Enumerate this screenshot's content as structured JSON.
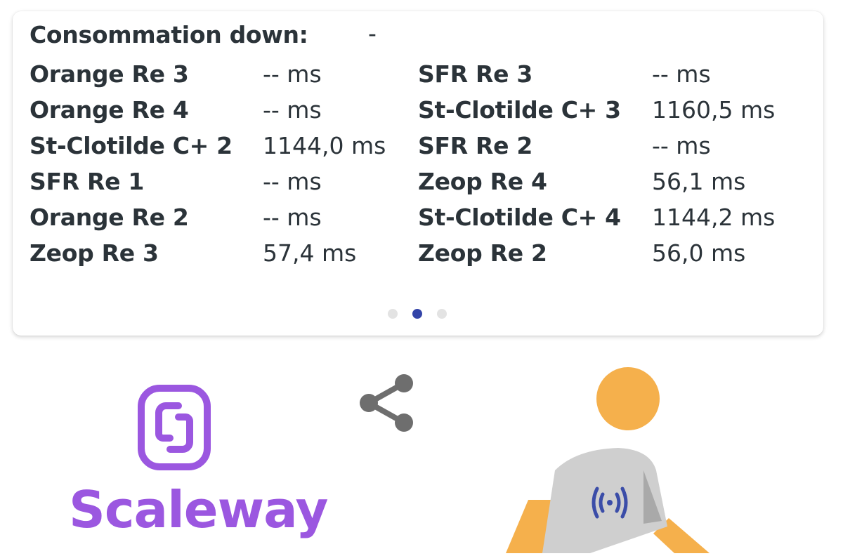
{
  "card": {
    "header": {
      "label": "Consommation down:",
      "value": "-"
    },
    "left_rows": [
      {
        "name": "Orange Re 3",
        "value": "-- ms"
      },
      {
        "name": "Orange Re 4",
        "value": "-- ms"
      },
      {
        "name": "St-Clotilde C+ 2",
        "value": "1144,0 ms"
      },
      {
        "name": "SFR Re 1",
        "value": "-- ms"
      },
      {
        "name": "Orange Re 2",
        "value": "-- ms"
      },
      {
        "name": "Zeop Re 3",
        "value": "57,4 ms"
      }
    ],
    "right_rows": [
      {
        "name": "SFR Re 3",
        "value": "-- ms"
      },
      {
        "name": "St-Clotilde C+ 3",
        "value": "1160,5 ms"
      },
      {
        "name": "SFR Re 2",
        "value": "-- ms"
      },
      {
        "name": "Zeop Re 4",
        "value": "56,1 ms"
      },
      {
        "name": "St-Clotilde C+ 4",
        "value": "1144,2 ms"
      },
      {
        "name": "Zeop Re 2",
        "value": "56,0 ms"
      }
    ],
    "pager": {
      "total": 3,
      "active_index": 1
    }
  },
  "footer": {
    "logo_text": "Scaleway",
    "share_icon": "share-icon",
    "figure_icon": "person-signal-icon"
  },
  "colors": {
    "text": "#2b3339",
    "brand_purple": "#9b57e0",
    "pager_active": "#3344a8",
    "pager_inactive": "#e3e3e3",
    "share_gray": "#6e6e6e",
    "figure_orange": "#f5b04c",
    "figure_shirt": "#cfcfcf"
  }
}
